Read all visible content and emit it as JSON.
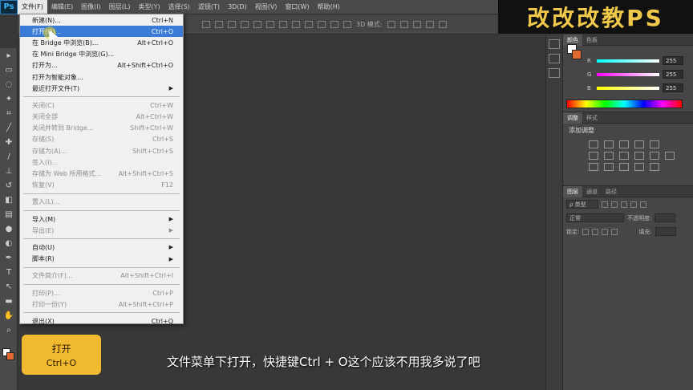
{
  "app": {
    "logo": "Ps"
  },
  "brand": {
    "text": "改改改教PS"
  },
  "menubar": [
    {
      "label": "文件(F)",
      "active": true
    },
    {
      "label": "编辑(E)"
    },
    {
      "label": "图像(I)"
    },
    {
      "label": "图层(L)"
    },
    {
      "label": "类型(Y)"
    },
    {
      "label": "选择(S)"
    },
    {
      "label": "滤镜(T)"
    },
    {
      "label": "3D(D)"
    },
    {
      "label": "视图(V)"
    },
    {
      "label": "窗口(W)"
    },
    {
      "label": "帮助(H)"
    }
  ],
  "options_bar": {
    "mode_label": "3D 模式:"
  },
  "file_menu": {
    "groups": [
      [
        {
          "label": "新建(N)...",
          "shortcut": "Ctrl+N"
        },
        {
          "label": "打开(O)...",
          "shortcut": "Ctrl+O",
          "highlighted": true
        },
        {
          "label": "在 Bridge 中浏览(B)...",
          "shortcut": "Alt+Ctrl+O"
        },
        {
          "label": "在 Mini Bridge 中浏览(G)...",
          "shortcut": ""
        },
        {
          "label": "打开为...",
          "shortcut": "Alt+Shift+Ctrl+O"
        },
        {
          "label": "打开为智能对象...",
          "shortcut": ""
        },
        {
          "label": "最近打开文件(T)",
          "shortcut": "",
          "submenu": true
        }
      ],
      [
        {
          "label": "关闭(C)",
          "shortcut": "Ctrl+W",
          "disabled": true
        },
        {
          "label": "关闭全部",
          "shortcut": "Alt+Ctrl+W",
          "disabled": true
        },
        {
          "label": "关闭并转到 Bridge...",
          "shortcut": "Shift+Ctrl+W",
          "disabled": true
        },
        {
          "label": "存储(S)",
          "shortcut": "Ctrl+S",
          "disabled": true
        },
        {
          "label": "存储为(A)...",
          "shortcut": "Shift+Ctrl+S",
          "disabled": true
        },
        {
          "label": "签入(I)...",
          "shortcut": "",
          "disabled": true
        },
        {
          "label": "存储为 Web 所用格式...",
          "shortcut": "Alt+Shift+Ctrl+S",
          "disabled": true
        },
        {
          "label": "恢复(V)",
          "shortcut": "F12",
          "disabled": true
        }
      ],
      [
        {
          "label": "置入(L)...",
          "shortcut": "",
          "disabled": true
        }
      ],
      [
        {
          "label": "导入(M)",
          "shortcut": "",
          "submenu": true
        },
        {
          "label": "导出(E)",
          "shortcut": "",
          "submenu": true,
          "disabled": true
        }
      ],
      [
        {
          "label": "自动(U)",
          "shortcut": "",
          "submenu": true
        },
        {
          "label": "脚本(R)",
          "shortcut": "",
          "submenu": true
        }
      ],
      [
        {
          "label": "文件简介(F)...",
          "shortcut": "Alt+Shift+Ctrl+I",
          "disabled": true
        }
      ],
      [
        {
          "label": "打印(P)...",
          "shortcut": "Ctrl+P",
          "disabled": true
        },
        {
          "label": "打印一份(Y)",
          "shortcut": "Alt+Shift+Ctrl+P",
          "disabled": true
        }
      ],
      [
        {
          "label": "退出(X)",
          "shortcut": "Ctrl+Q"
        }
      ]
    ]
  },
  "color_panel": {
    "tabs": [
      "颜色",
      "色板"
    ],
    "channels": [
      {
        "label": "R",
        "value": "255",
        "gradient": "linear-gradient(90deg,#0ff,#fff)"
      },
      {
        "label": "G",
        "value": "255",
        "gradient": "linear-gradient(90deg,#f0f,#fff)"
      },
      {
        "label": "B",
        "value": "255",
        "gradient": "linear-gradient(90deg,#ff0,#fff)"
      }
    ],
    "foreground": "#ffffff",
    "background": "#e06a30"
  },
  "adjust_panel": {
    "tabs": [
      "调整",
      "样式"
    ],
    "title": "添加调整"
  },
  "layers_panel": {
    "tabs": [
      "图层",
      "通道",
      "路径"
    ],
    "filter_label": "ρ 类型",
    "blend_mode": "正常",
    "opacity_label": "不透明度:",
    "lock_label": "锁定:",
    "fill_label": "填充:"
  },
  "caption": "文件菜单下打开，快捷键Ctrl + O这个应该不用我多说了吧",
  "keycard": {
    "action": "打开",
    "shortcut": "Ctrl+O"
  }
}
